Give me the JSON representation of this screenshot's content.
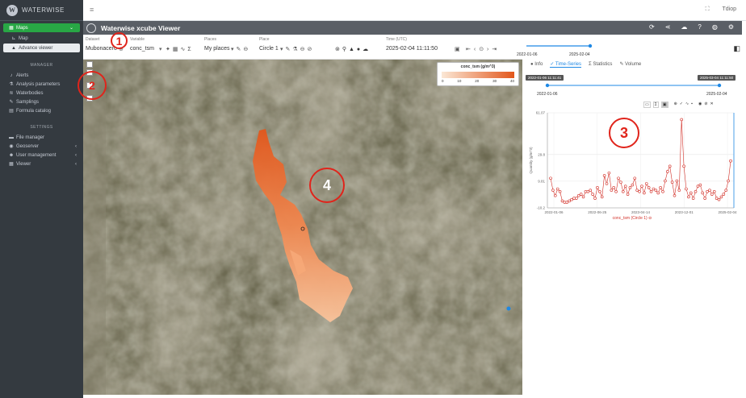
{
  "app": {
    "brand": "WATERWISE",
    "topbar_user": "Tdiop",
    "menu_label": "≡"
  },
  "sidebar": {
    "maps_label": "Maps",
    "items": [
      {
        "label": "Map"
      },
      {
        "label": "Advance viewer"
      }
    ],
    "manager_header": "MANAGER",
    "manager_items": [
      {
        "label": "Alerts"
      },
      {
        "label": "Analysis parameters"
      },
      {
        "label": "Waterbodies"
      },
      {
        "label": "Samplings"
      },
      {
        "label": "Formula catalog"
      }
    ],
    "settings_header": "SETTINGS",
    "settings_items": [
      {
        "label": "File manager"
      },
      {
        "label": "Geoserver"
      },
      {
        "label": "User management"
      },
      {
        "label": "Viewer"
      }
    ]
  },
  "viewer": {
    "title": "Waterwise xcube Viewer"
  },
  "toolbar": {
    "dataset_label": "Dataset",
    "dataset_value": "Mubonacero",
    "variable_label": "Variable",
    "variable_value": "conc_tsm",
    "places_label": "Places",
    "places_value": "My places",
    "place_label": "Place",
    "place_value": "Circle 1",
    "time_label": "Time (UTC)",
    "time_value": "2025-02-04 11:11:50"
  },
  "time_slider": {
    "start": "2022-01-06",
    "end": "2025-02-04",
    "position": 1.0
  },
  "panel": {
    "tabs": [
      {
        "label": "Info"
      },
      {
        "label": "Time-Series"
      },
      {
        "label": "Statistics"
      },
      {
        "label": "Volume"
      }
    ],
    "range_start_chip": "2022-01-06 11:11:41",
    "range_end_chip": "2025-03-04 11:11:50",
    "range_start": "2022-01-06",
    "range_end": "2025-02-04"
  },
  "legend": {
    "title": "conc_tsm (g/m^3)",
    "ticks": [
      "0",
      "10",
      "20",
      "30",
      "40"
    ],
    "colors": {
      "low": "#fbe8d6",
      "high": "#e2561b"
    }
  },
  "annotations": [
    "1",
    "2",
    "3",
    "4"
  ],
  "chart_data": {
    "type": "line",
    "ylabel": "Quantity (g/m^3)",
    "yticks": [
      "61.07",
      "29.8",
      "9.81",
      "-10.2"
    ],
    "xticks": [
      "2022-01-06",
      "2022-06-25",
      "2023-04-14",
      "2023-12-01",
      "2025-02-04"
    ],
    "ylim": [
      -10.2,
      61.07
    ],
    "legend": "conc_tsm (Circle 1)",
    "series": [
      {
        "name": "conc_tsm (Circle 1)",
        "values": [
          12,
          3,
          -1,
          4,
          2,
          -5,
          -6,
          -6,
          -5,
          -4,
          -3,
          -3,
          -1,
          0,
          -2,
          2,
          2,
          3,
          0,
          -3,
          5,
          2,
          -2,
          14,
          8,
          16,
          3,
          5,
          2,
          12,
          9,
          2,
          6,
          0,
          5,
          7,
          12,
          3,
          2,
          6,
          1,
          8,
          5,
          2,
          4,
          3,
          1,
          5,
          2,
          10,
          17,
          21,
          9,
          -1,
          10,
          3,
          56,
          21,
          4,
          -2,
          1,
          -3,
          2,
          6,
          7,
          1,
          -3,
          2,
          3,
          0,
          2,
          -3,
          -4,
          -2,
          0,
          3,
          10,
          25
        ],
        "color": "#d22f27"
      }
    ]
  }
}
